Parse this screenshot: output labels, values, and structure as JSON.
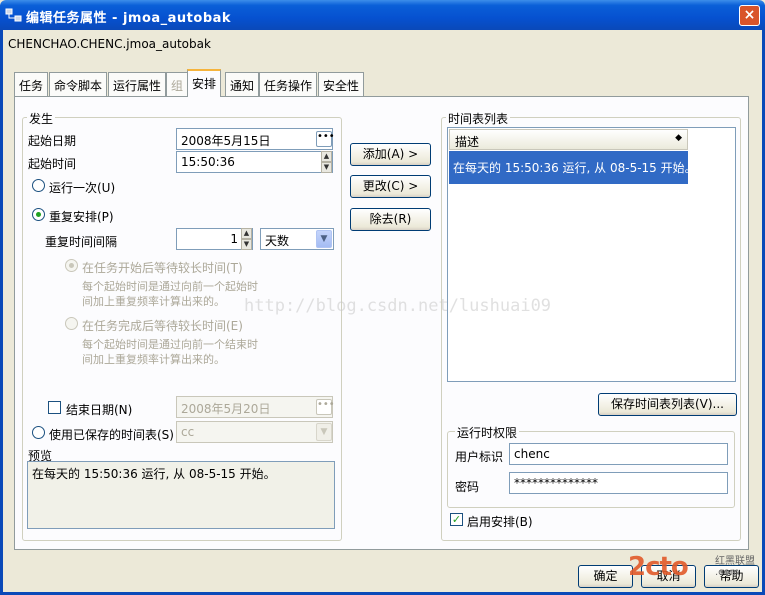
{
  "window": {
    "title": "编辑任务属性 - jmoa_autobak",
    "close_label": "×"
  },
  "object_name": "CHENCHAO.CHENC.jmoa_autobak",
  "tabs": [
    {
      "label": "任务"
    },
    {
      "label": "命令脚本"
    },
    {
      "label": "运行属性"
    },
    {
      "label": "组"
    },
    {
      "label": "安排"
    },
    {
      "label": "通知"
    },
    {
      "label": "任务操作"
    },
    {
      "label": "安全性"
    }
  ],
  "active_tab": "安排",
  "occurrence": {
    "group_label": "发生",
    "start_date_label": "起始日期",
    "start_date_value": "2008年5月15日",
    "start_time_label": "起始时间",
    "start_time_value": "15:50:36",
    "run_once_label": "运行一次(U)",
    "repeat_label": "重复安排(P)",
    "repeat_interval_label": "重复时间间隔",
    "repeat_interval_value": "1",
    "repeat_unit_value": "天数",
    "wait_after_start_label": "在任务开始后等待较长时间(T)",
    "wait_after_start_desc_1": "每个起始时间是通过向前一个起始时",
    "wait_after_start_desc_2": "间加上重复频率计算出来的。",
    "wait_after_finish_label": "在任务完成后等待较长时间(E)",
    "wait_after_finish_desc_1": "每个起始时间是通过向前一个结束时",
    "wait_after_finish_desc_2": "间加上重复频率计算出来的。",
    "end_date_label": "结束日期(N)",
    "end_date_value": "2008年5月20日",
    "saved_schedule_label": "使用已保存的时间表(S)",
    "saved_schedule_value": "cc",
    "preview_label": "预览",
    "preview_text": "在每天的 15:50:36 运行, 从 08-5-15 开始。"
  },
  "middle_buttons": {
    "add": "添加(A) >",
    "change": "更改(C) >",
    "remove": "除去(R)"
  },
  "schedule_list": {
    "group_label": "时间表列表",
    "column_header": "描述",
    "items": [
      "在每天的 15:50:36 运行, 从 08-5-15 开始。"
    ],
    "save_button": "保存时间表列表(V)..."
  },
  "runtime_permissions": {
    "group_label": "运行时权限",
    "user_label": "用户标识",
    "user_value": "chenc",
    "password_label": "密码",
    "password_value": "**************"
  },
  "enable_schedule": {
    "label": "启用安排(B)",
    "checked": true
  },
  "dialog_buttons": {
    "ok": "确定",
    "cancel": "取消",
    "help": "帮助"
  },
  "watermarks": {
    "url": "http://blog.csdn.net/lushuai09",
    "logo": "2cto",
    "logo_sub_1": "红黑联盟",
    "logo_sub_2": ".com"
  }
}
